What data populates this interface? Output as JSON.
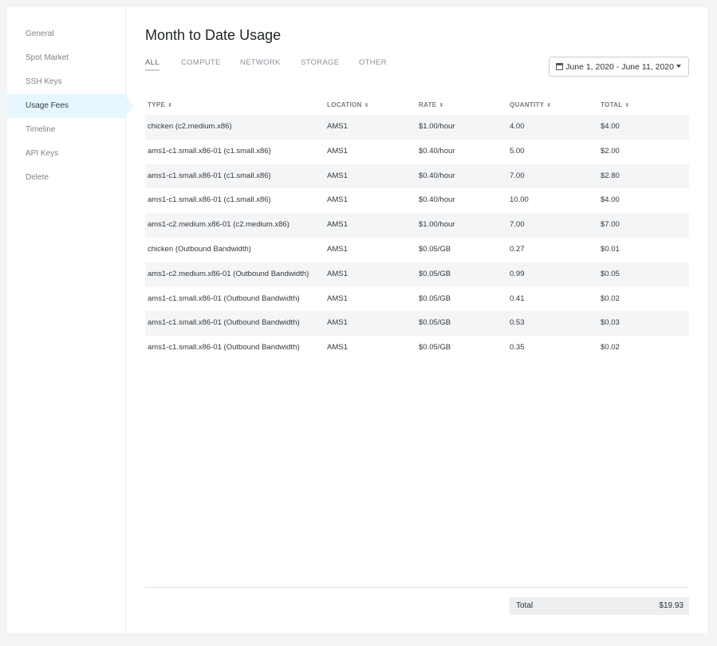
{
  "sidebar": {
    "items": [
      {
        "label": "General"
      },
      {
        "label": "Spot Market"
      },
      {
        "label": "SSH Keys"
      },
      {
        "label": "Usage Fees"
      },
      {
        "label": "Timeline"
      },
      {
        "label": "API Keys"
      },
      {
        "label": "Delete"
      }
    ],
    "active_label": "Usage Fees"
  },
  "main": {
    "title": "Month to Date Usage",
    "tabs": [
      {
        "label": "ALL"
      },
      {
        "label": "COMPUTE"
      },
      {
        "label": "NETWORK"
      },
      {
        "label": "STORAGE"
      },
      {
        "label": "OTHER"
      }
    ],
    "active_tab": "ALL",
    "date_range": {
      "label": "June 1, 2020 - June 11, 2020",
      "icon": "calendar-icon"
    }
  },
  "table": {
    "headers": [
      "TYPE",
      "LOCATION",
      "RATE",
      "QUANTITY",
      "TOTAL"
    ],
    "rows": [
      {
        "type": "chicken (c2.medium.x86)",
        "location": "AMS1",
        "rate": "$1.00/hour",
        "quantity": "4.00",
        "total": "$4.00"
      },
      {
        "type": "ams1-c1.small.x86-01 (c1.small.x86)",
        "location": "AMS1",
        "rate": "$0.40/hour",
        "quantity": "5.00",
        "total": "$2.00"
      },
      {
        "type": "ams1-c1.small.x86-01 (c1.small.x86)",
        "location": "AMS1",
        "rate": "$0.40/hour",
        "quantity": "7.00",
        "total": "$2.80"
      },
      {
        "type": "ams1-c1.small.x86-01 (c1.small.x86)",
        "location": "AMS1",
        "rate": "$0.40/hour",
        "quantity": "10.00",
        "total": "$4.00"
      },
      {
        "type": "ams1-c2.medium.x86-01 (c2.medium.x86)",
        "location": "AMS1",
        "rate": "$1.00/hour",
        "quantity": "7.00",
        "total": "$7.00"
      },
      {
        "type": "chicken (Outbound Bandwidth)",
        "location": "AMS1",
        "rate": "$0.05/GB",
        "quantity": "0.27",
        "total": "$0.01"
      },
      {
        "type": "ams1-c2.medium.x86-01 (Outbound Bandwidth)",
        "location": "AMS1",
        "rate": "$0.05/GB",
        "quantity": "0.99",
        "total": "$0.05"
      },
      {
        "type": "ams1-c1.small.x86-01 (Outbound Bandwidth)",
        "location": "AMS1",
        "rate": "$0.05/GB",
        "quantity": "0.41",
        "total": "$0.02"
      },
      {
        "type": "ams1-c1.small.x86-01 (Outbound Bandwidth)",
        "location": "AMS1",
        "rate": "$0.05/GB",
        "quantity": "0.53",
        "total": "$0.03"
      },
      {
        "type": "ams1-c1.small.x86-01 (Outbound Bandwidth)",
        "location": "AMS1",
        "rate": "$0.05/GB",
        "quantity": "0.35",
        "total": "$0.02"
      }
    ]
  },
  "summary": {
    "label": "Total",
    "value": "$19.93"
  },
  "colors": {
    "active_sidebar_bg": "#e8f7fd",
    "row_shade": "#f4f5f6"
  }
}
